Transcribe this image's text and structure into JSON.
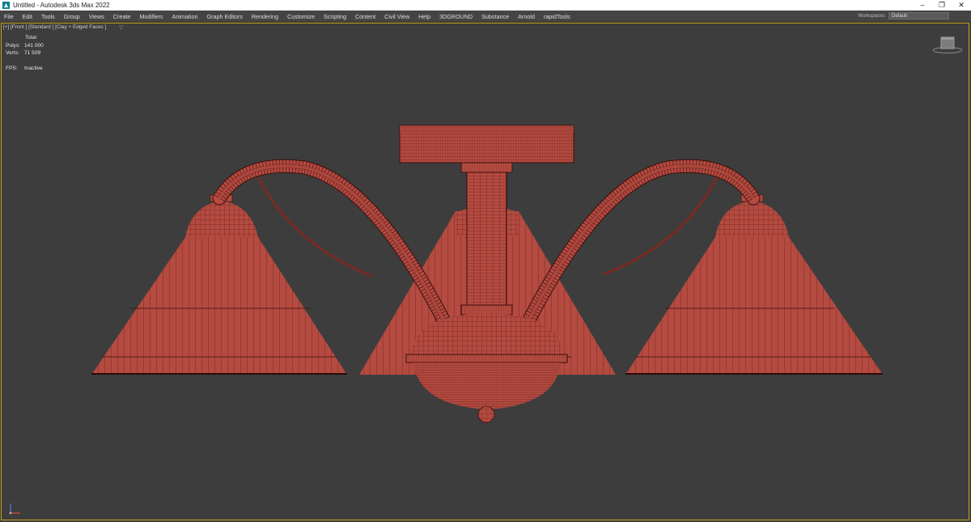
{
  "window": {
    "title": "Untitled - Autodesk 3ds Max 2022"
  },
  "menu": [
    "File",
    "Edit",
    "Tools",
    "Group",
    "Views",
    "Create",
    "Modifiers",
    "Animation",
    "Graph Editors",
    "Rendering",
    "Customize",
    "Scripting",
    "Content",
    "Civil View",
    "Help",
    "3DGROUND",
    "Substance",
    "Arnold",
    "rapidTools"
  ],
  "workspace": {
    "label": "Workspaces:",
    "value": "Default"
  },
  "viewport": {
    "label": "[+] [Front ] [Standard ] [Clay + Edged Faces ]",
    "stats": {
      "header": "Total",
      "polys_label": "Polys:",
      "polys": "141 000",
      "verts_label": "Verts:",
      "verts": "71 509",
      "fps_label": "FPS:",
      "fps": "Inactive"
    }
  },
  "colors": {
    "background": "#3d3d3d",
    "clay": "#b44a40",
    "wire": "#3a0f0c",
    "active_border": "#c6a21a"
  }
}
